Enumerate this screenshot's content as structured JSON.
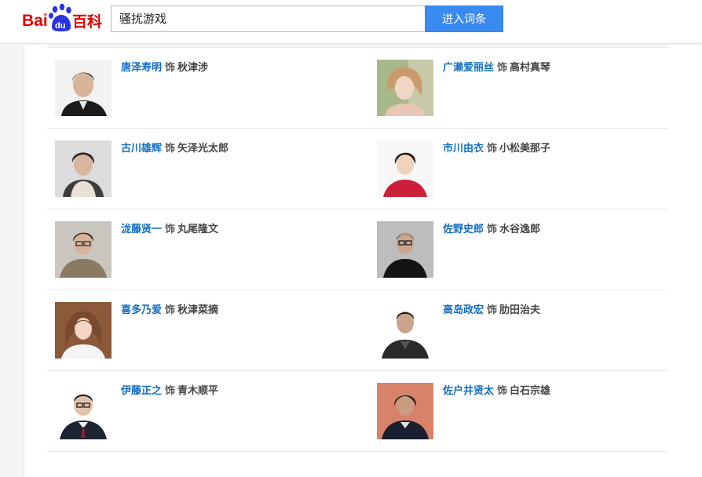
{
  "header": {
    "logo_text": "Bai百科",
    "logo_paw_text": "du",
    "search_value": "骚扰游戏",
    "search_button": "进入词条"
  },
  "cast": [
    {
      "actor": "唐泽寿明",
      "sep": "饰",
      "role": "秋津涉",
      "photo_icon": "actor-photo"
    },
    {
      "actor": "广濑爱丽丝",
      "sep": "饰",
      "role": "高村真琴",
      "photo_icon": "actor-photo"
    },
    {
      "actor": "古川雄辉",
      "sep": "饰",
      "role": "矢泽光太郎",
      "photo_icon": "actor-photo"
    },
    {
      "actor": "市川由衣",
      "sep": "饰",
      "role": "小松美那子",
      "photo_icon": "actor-photo"
    },
    {
      "actor": "泷藤贤一",
      "sep": "饰",
      "role": "丸尾隆文",
      "photo_icon": "actor-photo"
    },
    {
      "actor": "佐野史郎",
      "sep": "饰",
      "role": "水谷逸郎",
      "photo_icon": "actor-photo"
    },
    {
      "actor": "喜多乃爱",
      "sep": "饰",
      "role": "秋津菜摘",
      "photo_icon": "actor-photo"
    },
    {
      "actor": "高岛政宏",
      "sep": "饰",
      "role": "肋田治夫",
      "photo_icon": "actor-photo"
    },
    {
      "actor": "伊藤正之",
      "sep": "饰",
      "role": "青木顺平",
      "photo_icon": "actor-photo"
    },
    {
      "actor": "佐户井贤太",
      "sep": "饰",
      "role": "白石宗雄",
      "photo_icon": "actor-photo"
    }
  ],
  "colors": {
    "link_blue": "#136ec2",
    "button_blue": "#3a8bf1",
    "logo_red": "#e10601",
    "logo_blue": "#2932e1"
  }
}
